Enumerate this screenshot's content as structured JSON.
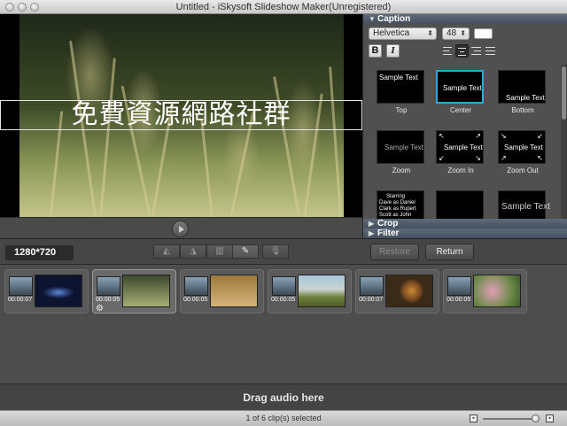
{
  "window": {
    "title": "Untitled - iSkysoft Slideshow Maker(Unregistered)"
  },
  "preview": {
    "caption_text": "免費資源網路社群"
  },
  "caption_panel": {
    "section_label": "Caption",
    "font": "Helvetica",
    "font_size": "48",
    "bold_label": "B",
    "italic_label": "I",
    "styles": [
      {
        "label": "Top",
        "sample": "Sample Text"
      },
      {
        "label": "Center",
        "sample": "Sample Text",
        "selected": true
      },
      {
        "label": "Bottom",
        "sample": "Sample Text"
      },
      {
        "label": "Zoom",
        "sample": "Sample Text"
      },
      {
        "label": "Zoom In",
        "sample": "Sample Text"
      },
      {
        "label": "Zoom Out",
        "sample": "Sample Text"
      },
      {
        "label": "",
        "sample": "Starring Dave as Daniel Clark as Rupert Scott as John"
      },
      {
        "label": "",
        "sample": ""
      },
      {
        "label": "",
        "sample": "Sample Text"
      }
    ],
    "credit_lines": [
      "Starring",
      "Dave     as Daniel",
      "Clark    as Rupert",
      "Scott    as John"
    ]
  },
  "crop_section": {
    "label": "Crop"
  },
  "filter_section": {
    "label": "Filter"
  },
  "toolbar": {
    "resolution": "1280*720",
    "restore_label": "Restore",
    "return_label": "Return"
  },
  "clips": [
    {
      "time": "00:00:07",
      "image": "galaxy"
    },
    {
      "time": "00:00:05",
      "image": "grass",
      "selected": true
    },
    {
      "time": "00:00:05",
      "image": "bird-field"
    },
    {
      "time": "00:00:05",
      "image": "elephant"
    },
    {
      "time": "00:00:07",
      "image": "lion"
    },
    {
      "time": "00:00:05",
      "image": "flowers"
    }
  ],
  "audio": {
    "drop_label": "Drag audio here"
  },
  "status": {
    "text": "1 of 6 clip(s) selected"
  },
  "colors": {
    "accent": "#2ea7d8",
    "caption_color": "#ffffff"
  }
}
